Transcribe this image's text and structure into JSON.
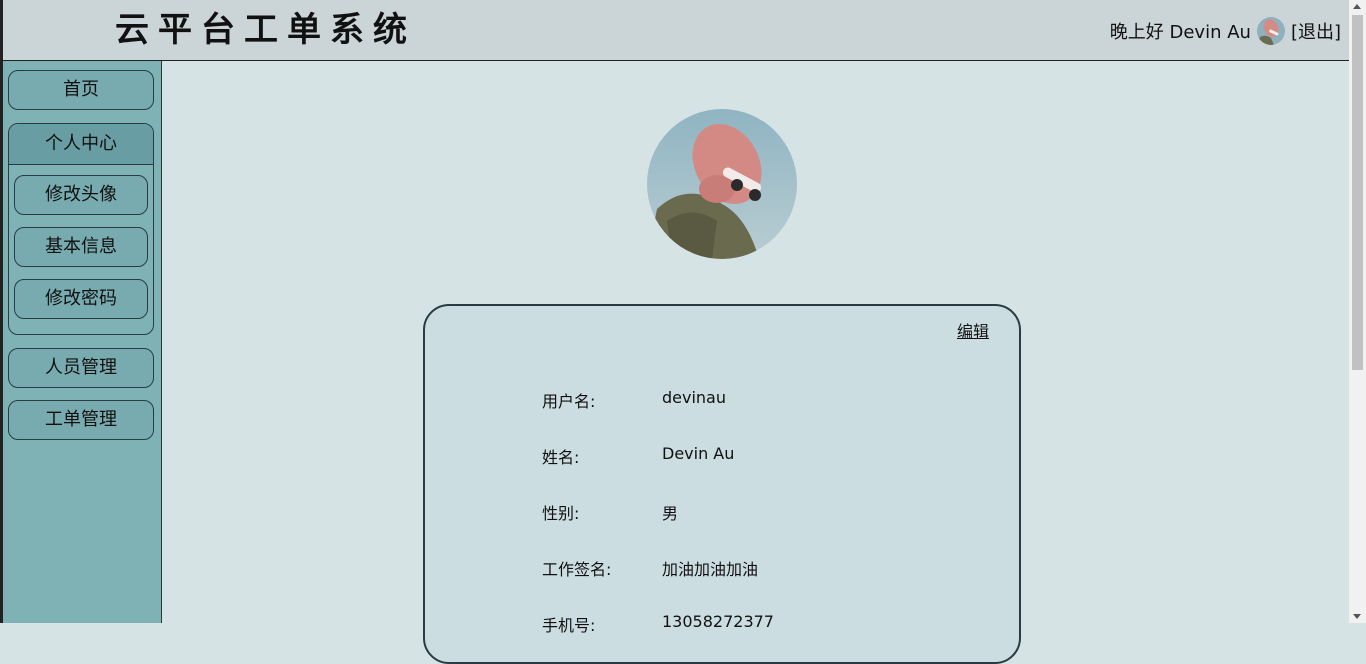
{
  "app": {
    "title": "云平台工单系统"
  },
  "header": {
    "greeting": "晚上好 Devin Au",
    "logout_label": "[退出]"
  },
  "sidebar": {
    "home": "首页",
    "personal_center": "个人中心",
    "sub_items": [
      "修改头像",
      "基本信息",
      "修改密码"
    ],
    "staff_management": "人员管理",
    "ticket_management": "工单管理"
  },
  "profile": {
    "edit_label": "编辑",
    "fields": [
      {
        "label": "用户名:",
        "value": "devinau"
      },
      {
        "label": "姓名:",
        "value": "Devin Au"
      },
      {
        "label": "性别:",
        "value": "男"
      },
      {
        "label": "工作签名:",
        "value": "加油加油加油"
      },
      {
        "label": "手机号:",
        "value": "13058272377"
      }
    ]
  },
  "colors": {
    "page_bg": "#d6e3e5",
    "header_bg": "#cbd5d8",
    "sidebar_bg": "#7fb2b5",
    "button_bg": "#77abb0",
    "card_bg": "#ccdde2",
    "border": "#2a3b45"
  }
}
